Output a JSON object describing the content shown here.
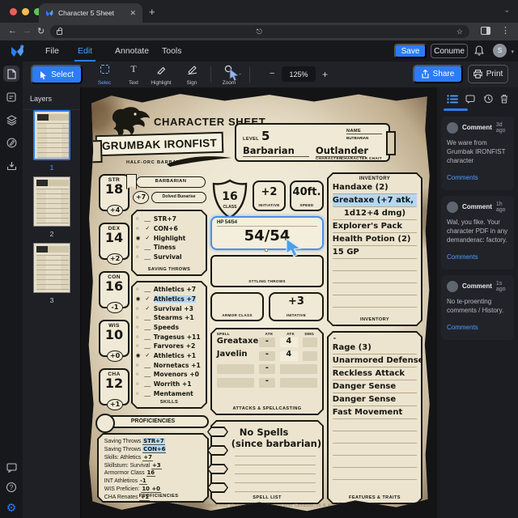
{
  "browser": {
    "tab_title": "Character 5 Sheet"
  },
  "appbar": {
    "menus": [
      "File",
      "Edit",
      "Annotate",
      "Tools"
    ],
    "save": "Save",
    "consume": "Conume",
    "avatar": "S"
  },
  "toolbar": {
    "select": "Select",
    "selec": "Selec",
    "text": "Text",
    "highlight": "Highlight",
    "sign": "Sign",
    "zoom_tool": "Zoom",
    "zoom_value": "125%",
    "share": "Share",
    "print": "Print"
  },
  "layers": {
    "title": "Layers",
    "pages": [
      "1",
      "2",
      "3"
    ]
  },
  "sheet": {
    "header": {
      "title": "CHARACTER SHEET",
      "name": "GRUMBAK IRONFIST",
      "subtitle": "HALF-ORC BARBATIR",
      "level_label": "LEVEL",
      "level": "5",
      "name_label": "NAME",
      "name_value": "BUTBARIAN",
      "class": "Barbarian",
      "background": "Outlander",
      "class_label": "CHARACTER",
      "background_label": "CHARACTER CHAIT"
    },
    "abilities": [
      {
        "abbr": "STR",
        "score": "18",
        "mod": "+4"
      },
      {
        "abbr": "DEX",
        "score": "14",
        "mod": "+2"
      },
      {
        "abbr": "CON",
        "score": "16",
        "mod": "-1"
      },
      {
        "abbr": "WIS",
        "score": "10",
        "mod": "+0"
      },
      {
        "abbr": "CHA",
        "score": "12",
        "mod": "+1"
      }
    ],
    "ribbon": "BARBARIAN",
    "prof": {
      "bonus": "+7",
      "label": "Dolved Bunarise"
    },
    "saves": {
      "rows": [
        {
          "radio": "○",
          "mark": "__",
          "label": "STR+7"
        },
        {
          "radio": "○",
          "mark": "✓",
          "label": "CON+6"
        },
        {
          "radio": "◉",
          "mark": "✓",
          "label": "Highlight"
        },
        {
          "radio": "○",
          "mark": "__",
          "label": "Tiness"
        },
        {
          "radio": "○",
          "mark": "__",
          "label": "Survival"
        }
      ],
      "label": "SAVING THROWS"
    },
    "skills": {
      "rows": [
        {
          "radio": "○",
          "mark": "__",
          "label": "Athletics +7"
        },
        {
          "radio": "◉",
          "mark": "✓",
          "label": "Athletics +7"
        },
        {
          "radio": "○",
          "mark": "✓",
          "label": "Survival +3"
        },
        {
          "radio": "○",
          "mark": "__",
          "label": "Stearms +1"
        },
        {
          "radio": "○",
          "mark": "__",
          "label": "Speeds"
        },
        {
          "radio": "○",
          "mark": "__",
          "label": "Tragesus +11"
        },
        {
          "radio": "○",
          "mark": "__",
          "label": "Farvores +2"
        },
        {
          "radio": "◉",
          "mark": "✓",
          "label": "Athletics +1"
        },
        {
          "radio": "○",
          "mark": "__",
          "label": "Nornetacs +1"
        },
        {
          "radio": "○",
          "mark": "__",
          "label": "Movenors +0"
        },
        {
          "radio": "○",
          "mark": "__",
          "label": "Worrith +1"
        },
        {
          "radio": "○",
          "mark": "__",
          "label": "Mentament"
        }
      ],
      "label": "SKILLS"
    },
    "prof_banner": "PROFICIENCIES",
    "prof_list": {
      "rows": [
        {
          "t": "Saving Throws",
          "v": "STR+7"
        },
        {
          "t": "Saving Throws",
          "v": "CON+6"
        },
        {
          "t": "Skills:  Athletics",
          "v": "+7"
        },
        {
          "t": "Skillsturn:  Survival",
          "v": "+3"
        },
        {
          "t": "Armormor Class",
          "v": "16"
        },
        {
          "t": "INT  Athletiros",
          "v": "-1"
        },
        {
          "t": "WIS  Preficien:",
          "v": "10 +0"
        },
        {
          "t": "CHA Renates",
          "v": "+1"
        }
      ],
      "label": "PROFICIENCIES"
    },
    "combat": {
      "ac": {
        "value": "16",
        "label": "CLASS"
      },
      "init": {
        "value": "+2",
        "label": "INITIATIVE"
      },
      "speed": {
        "value": "40ft.",
        "label": "SPEED"
      },
      "hp_label": "HP 54/54",
      "hp_value": "54/54",
      "sttling": "STTLING THROWS",
      "armor_label": "ARMOR CLASS",
      "init2": {
        "value": "+3",
        "label": "INITATIVE"
      }
    },
    "attacks": {
      "headers": [
        "SPELL",
        "ATK",
        "ATK",
        "DMG"
      ],
      "rows": [
        {
          "name": "Greataxe",
          "atk1": "-",
          "atk2": "4",
          "dmg": ""
        },
        {
          "name": "Javelin",
          "atk1": "-",
          "atk2": "4",
          "dmg": ""
        },
        {
          "name": "",
          "atk1": "-",
          "atk2": "",
          "dmg": ""
        },
        {
          "name": "",
          "atk1": "-",
          "atk2": "",
          "dmg": ""
        }
      ],
      "label": "ATTACKS & SPELLCASTING"
    },
    "spells": {
      "line1": "No Spells",
      "line2": "(since barbarian)",
      "label": "SPELL LIST"
    },
    "inventory": {
      "title": "INVENTORY",
      "items": [
        "Handaxe (2)",
        "Greataxe (+7 atk,",
        "1d12+4 dmg)",
        "Explorer's Pack",
        "Health Potion (2)",
        "15 GP"
      ],
      "label": "INVENTORY"
    },
    "features": {
      "dash": "-",
      "items": [
        "Rage (3)",
        "Unarmored Defense",
        "Reckless Attack",
        "Danger Sense",
        "Danger Sense",
        "Fast Movement"
      ],
      "label": "FEATURES & TRAITS"
    },
    "copyright": "© Copyright © 2023 Sa D&D Collesecision. Montosia soranmes Sarapcis teors. Gamaniea | Lit. B. All rights furthesneed."
  },
  "comments": {
    "items": [
      {
        "author": "Comment",
        "time": "3d ago",
        "text": "We ware from Grumbak IRONFIST character",
        "link": "Comments"
      },
      {
        "author": "Comment",
        "time": "1h ago",
        "text": "Wal, you fike. Your character PDF in any demanderac: factory.",
        "link": "Comments"
      },
      {
        "author": "Comment",
        "time": "1s ago",
        "text": "No te-proenting comments  / History.",
        "link": "Comments"
      }
    ]
  },
  "colors": {
    "accent": "#2b7cf6",
    "highlight": "#b5d7f3",
    "link": "#4d9fff"
  }
}
